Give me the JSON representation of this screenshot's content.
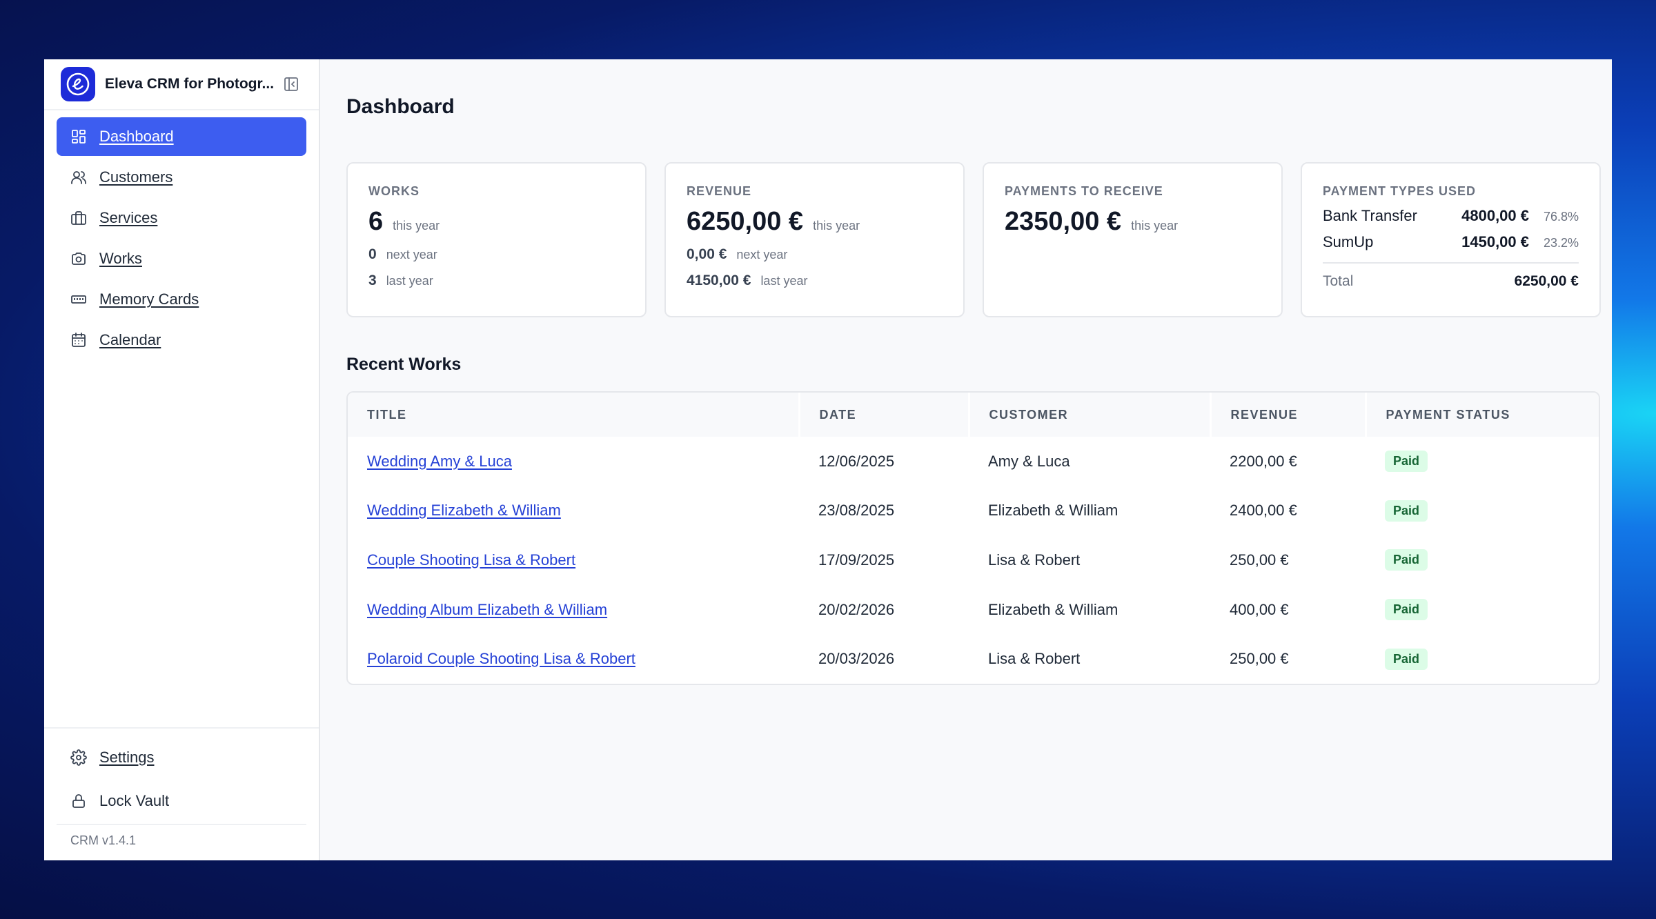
{
  "app": {
    "title": "Eleva CRM for Photogr...",
    "version": "CRM v1.4.1",
    "brand_color": "#1d2bd8",
    "accent_color": "#3d5df0"
  },
  "sidebar": {
    "items": [
      {
        "label": "Dashboard",
        "icon": "grid-icon",
        "active": true
      },
      {
        "label": "Customers",
        "icon": "users-icon"
      },
      {
        "label": "Services",
        "icon": "briefcase-icon"
      },
      {
        "label": "Works",
        "icon": "camera-icon"
      },
      {
        "label": "Memory Cards",
        "icon": "memory-card-icon"
      },
      {
        "label": "Calendar",
        "icon": "calendar-icon"
      }
    ],
    "bottom": [
      {
        "label": "Settings",
        "icon": "gear-icon"
      },
      {
        "label": "Lock Vault",
        "icon": "lock-icon"
      }
    ]
  },
  "main": {
    "title": "Dashboard",
    "cards": {
      "works": {
        "label": "WORKS",
        "this_year": "6",
        "this_year_label": "this year",
        "next_year": "0",
        "next_year_label": "next year",
        "last_year": "3",
        "last_year_label": "last year"
      },
      "revenue": {
        "label": "REVENUE",
        "this_year": "6250,00 €",
        "this_year_label": "this year",
        "next_year": "0,00 €",
        "next_year_label": "next year",
        "last_year": "4150,00 €",
        "last_year_label": "last year"
      },
      "payments": {
        "label": "PAYMENTS TO RECEIVE",
        "this_year": "2350,00 €",
        "this_year_label": "this year"
      },
      "payment_types": {
        "label": "PAYMENT TYPES USED",
        "rows": [
          {
            "name": "Bank Transfer",
            "amount": "4800,00 €",
            "pct": "76.8%"
          },
          {
            "name": "SumUp",
            "amount": "1450,00 €",
            "pct": "23.2%"
          }
        ],
        "total_label": "Total",
        "total_value": "6250,00 €"
      }
    },
    "recent": {
      "title": "Recent Works",
      "columns": [
        "TITLE",
        "DATE",
        "CUSTOMER",
        "REVENUE",
        "PAYMENT STATUS"
      ],
      "rows": [
        {
          "title": "Wedding Amy & Luca",
          "date": "12/06/2025",
          "customer": "Amy & Luca",
          "revenue": "2200,00 €",
          "status": "Paid"
        },
        {
          "title": "Wedding Elizabeth & William",
          "date": "23/08/2025",
          "customer": "Elizabeth & William",
          "revenue": "2400,00 €",
          "status": "Paid"
        },
        {
          "title": "Couple Shooting Lisa & Robert",
          "date": "17/09/2025",
          "customer": "Lisa & Robert",
          "revenue": "250,00 €",
          "status": "Paid"
        },
        {
          "title": "Wedding Album Elizabeth & William",
          "date": "20/02/2026",
          "customer": "Elizabeth & William",
          "revenue": "400,00 €",
          "status": "Paid"
        },
        {
          "title": "Polaroid Couple Shooting Lisa & Robert",
          "date": "20/03/2026",
          "customer": "Lisa & Robert",
          "revenue": "250,00 €",
          "status": "Paid"
        }
      ]
    }
  }
}
